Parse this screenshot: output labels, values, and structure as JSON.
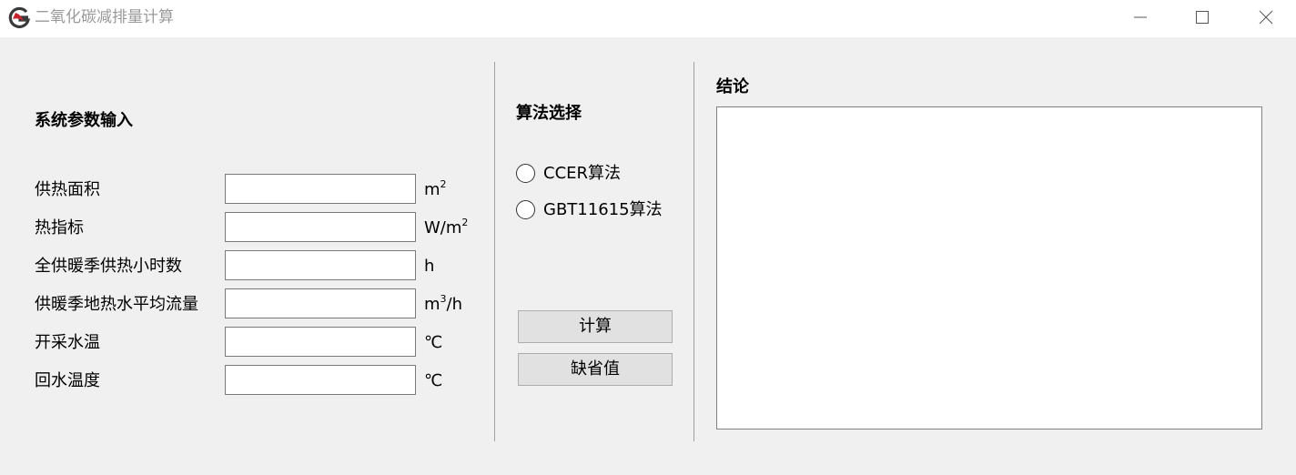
{
  "window": {
    "title": "二氧化碳减排量计算",
    "controls": [
      "minimize-icon",
      "maximize-icon",
      "close-icon"
    ]
  },
  "inputs": {
    "title": "系统参数输入",
    "params": [
      {
        "label": "供热面积",
        "value": "",
        "unit_base": "m",
        "unit_sup": "2",
        "unit_tail": ""
      },
      {
        "label": "热指标",
        "value": "",
        "unit_base": "W/m",
        "unit_sup": "2",
        "unit_tail": ""
      },
      {
        "label": "全供暖季供热小时数",
        "value": "",
        "unit_base": "h",
        "unit_sup": "",
        "unit_tail": ""
      },
      {
        "label": "供暖季地热水平均流量",
        "value": "",
        "unit_base": "m",
        "unit_sup": "3",
        "unit_tail": "/h"
      },
      {
        "label": "开采水温",
        "value": "",
        "unit_base": "℃",
        "unit_sup": "",
        "unit_tail": ""
      },
      {
        "label": "回水温度",
        "value": "",
        "unit_base": "℃",
        "unit_sup": "",
        "unit_tail": ""
      }
    ]
  },
  "algorithm": {
    "title": "算法选择",
    "options": [
      {
        "label": "CCER算法",
        "selected": false
      },
      {
        "label": "GBT11615算法",
        "selected": false
      }
    ]
  },
  "actions": {
    "calculate_label": "计算",
    "default_label": "缺省值"
  },
  "result": {
    "title": "结论",
    "text": ""
  },
  "colors": {
    "background": "#f0f0f0",
    "titlebar": "#ffffff",
    "title_text": "#9a9a9a",
    "logo_red": "#c8232c",
    "logo_dark": "#3a3a3a",
    "button_bg": "#e1e1e1",
    "border": "#7a7a7a"
  }
}
